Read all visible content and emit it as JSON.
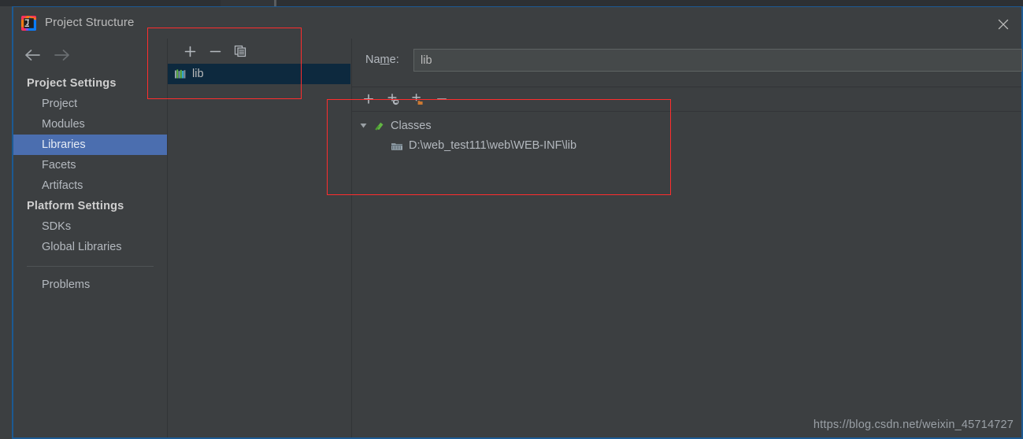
{
  "window": {
    "title": "Project Structure",
    "app_icon": "intellij-idea-icon",
    "close_icon": "close-icon"
  },
  "nav": {
    "back_icon": "arrow-left-icon",
    "forward_icon": "arrow-right-icon"
  },
  "sidebar": {
    "groups": [
      {
        "label": "Project Settings",
        "items": [
          {
            "label": "Project",
            "selected": false
          },
          {
            "label": "Modules",
            "selected": false
          },
          {
            "label": "Libraries",
            "selected": true
          },
          {
            "label": "Facets",
            "selected": false
          },
          {
            "label": "Artifacts",
            "selected": false
          }
        ]
      },
      {
        "label": "Platform Settings",
        "items": [
          {
            "label": "SDKs",
            "selected": false
          },
          {
            "label": "Global Libraries",
            "selected": false
          }
        ]
      }
    ],
    "footer_items": [
      {
        "label": "Problems",
        "selected": false
      }
    ]
  },
  "list_panel": {
    "toolbar": [
      {
        "name": "add-library-button",
        "icon": "plus-icon",
        "tooltip": "Add"
      },
      {
        "name": "remove-library-button",
        "icon": "minus-icon",
        "tooltip": "Remove"
      },
      {
        "name": "copy-library-button",
        "icon": "copy-icon",
        "tooltip": "Copy"
      }
    ],
    "libraries": [
      {
        "label": "lib",
        "icon": "library-icon",
        "selected": true
      }
    ]
  },
  "detail": {
    "name_label_prefix": "Na",
    "name_label_mnemonic": "m",
    "name_label_suffix": "e:",
    "name_value": "lib",
    "name_placeholder": "",
    "roots_toolbar": [
      {
        "name": "add-root-button",
        "icon": "plus-icon",
        "tooltip": "Attach Files or Directories"
      },
      {
        "name": "add-source-root-button",
        "icon": "plus-source-icon",
        "tooltip": "Attach Sources"
      },
      {
        "name": "add-jar-dir-button",
        "icon": "plus-folder-icon",
        "tooltip": "Attach Jar Directories"
      },
      {
        "name": "remove-root-button",
        "icon": "minus-icon",
        "tooltip": "Remove"
      }
    ],
    "tree": [
      {
        "label": "Classes",
        "icon": "classes-root-icon",
        "expanded": true,
        "toggle_icon": "triangle-down-icon",
        "children": [
          {
            "label": "D:\\web_test111\\web\\WEB-INF\\lib",
            "icon": "jar-directory-icon"
          }
        ]
      }
    ]
  },
  "watermark": {
    "text": "https://blog.csdn.net/weixin_45714727"
  },
  "annotations": [
    {
      "name": "annotation-rect-library-list",
      "color": "#ff2d2d"
    },
    {
      "name": "annotation-rect-library-roots",
      "color": "#ff2d2d"
    }
  ],
  "colors": {
    "window_bg": "#3c3f41",
    "selection_blue": "#4b6eaf",
    "list_selection": "#0d293e",
    "window_border": "#1c5a93",
    "annotation_red": "#ff2d2d"
  }
}
